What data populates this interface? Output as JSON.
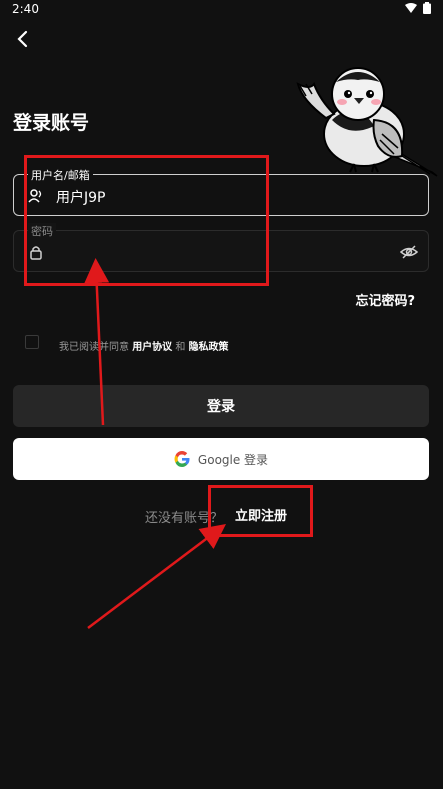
{
  "status_bar": {
    "time": "2:40"
  },
  "header": {
    "title": "登录账号"
  },
  "username_field": {
    "label": "用户名/邮箱",
    "value": "用户J9P"
  },
  "password_field": {
    "label": "密码",
    "value": ""
  },
  "forgot_password": "忘记密码?",
  "agreement": {
    "prefix": "我已阅读并同意",
    "terms": "用户协议",
    "and": "和",
    "privacy": "隐私政策",
    "checked": false
  },
  "login_button": "登录",
  "google_button": "Google 登录",
  "register": {
    "prompt": "还没有账号？",
    "link": "立即注册"
  },
  "colors": {
    "background": "#111111",
    "annotation": "#e0191b",
    "google_blue": "#4285F4",
    "google_red": "#EA4335",
    "google_yellow": "#FBBC05",
    "google_green": "#34A853"
  }
}
